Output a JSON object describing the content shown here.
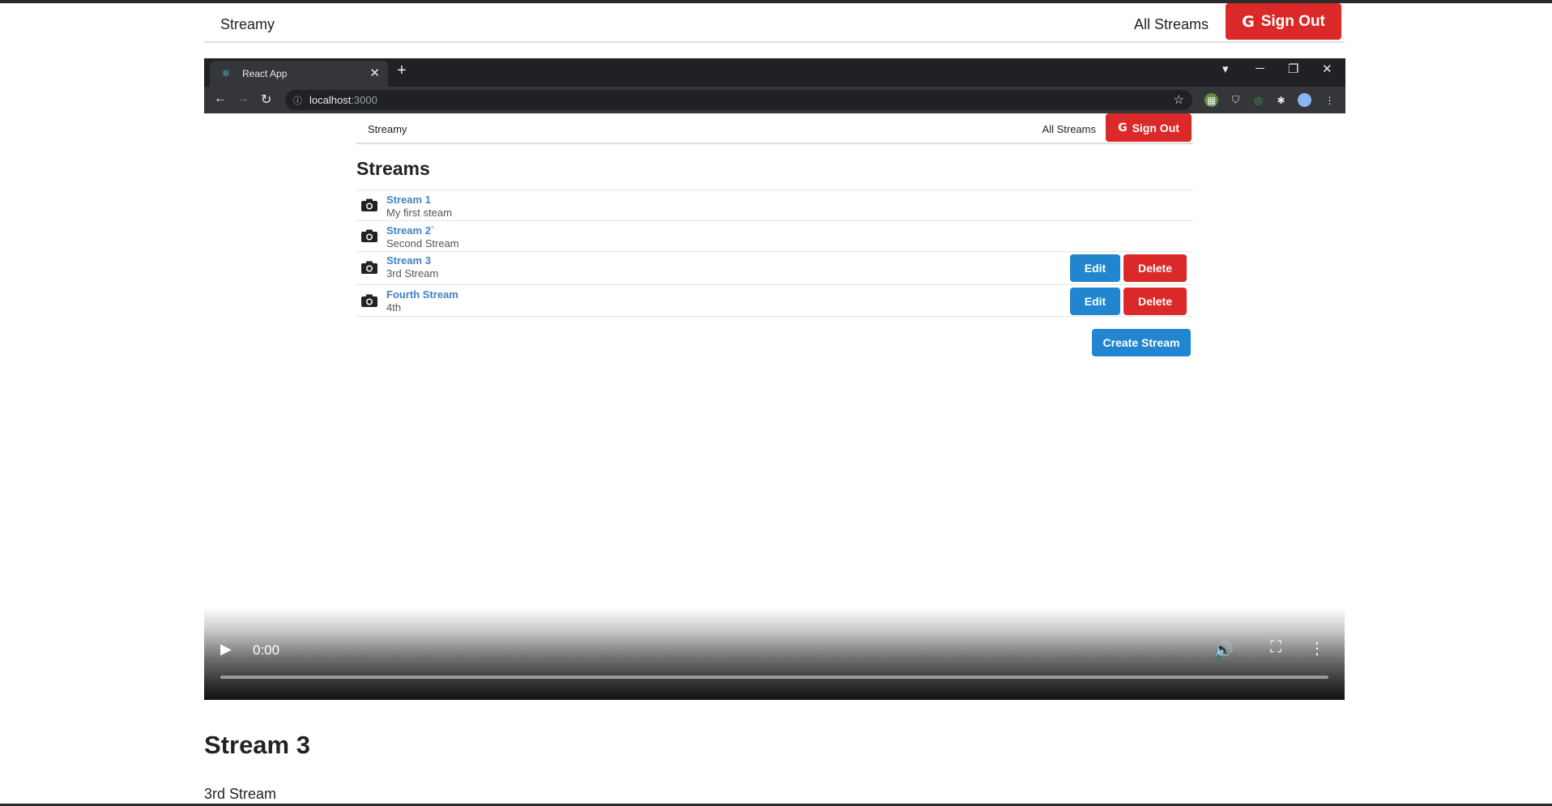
{
  "nav": {
    "brand": "Streamy",
    "all_streams": "All Streams",
    "sign_out": "Sign Out"
  },
  "browser": {
    "tab_title": "React App",
    "url_host": "localhost",
    "url_port": ":3000"
  },
  "inner": {
    "nav": {
      "brand": "Streamy",
      "all_streams": "All Streams",
      "sign_out": "Sign Out"
    },
    "heading": "Streams",
    "streams": [
      {
        "title": "Stream 1",
        "description": "My first steam",
        "owned": false
      },
      {
        "title": "Stream 2`",
        "description": "Second Stream",
        "owned": false
      },
      {
        "title": "Stream 3",
        "description": "3rd Stream",
        "owned": true
      },
      {
        "title": "Fourth Stream",
        "description": "4th",
        "owned": true
      }
    ],
    "edit_label": "Edit",
    "delete_label": "Delete",
    "create_label": "Create Stream"
  },
  "video": {
    "time": "0:00"
  },
  "detail": {
    "title": "Stream 3",
    "description": "3rd Stream"
  },
  "colors": {
    "primary": "#2185d0",
    "danger": "#db2828",
    "link": "#4183c4"
  }
}
